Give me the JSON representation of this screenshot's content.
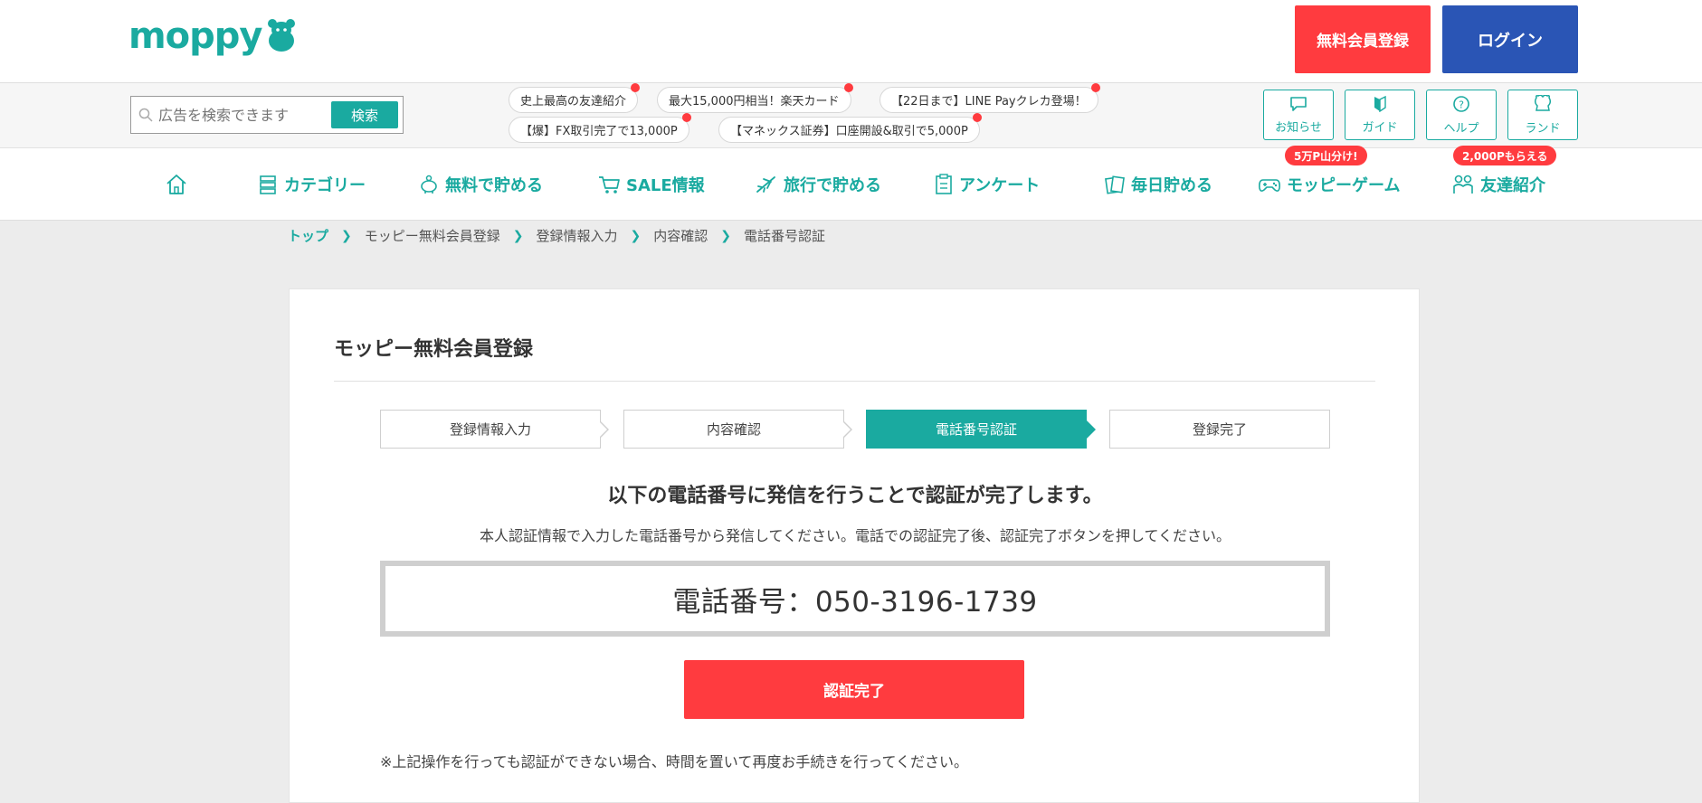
{
  "header": {
    "logo_text": "moppy",
    "register_label": "無料会員登録",
    "login_label": "ログイン"
  },
  "search": {
    "placeholder": "広告を検索できます",
    "button_label": "検索"
  },
  "promos": [
    "史上最高の友達紹介",
    "最大15,000円相当！楽天カード",
    "【22日まで】LINE Payクレカ登場！",
    "【爆】FX取引完了で13,000P",
    "【マネックス証券】口座開設&取引で5,000P"
  ],
  "utility_buttons": [
    {
      "label": "お知らせ",
      "icon": "chat-bubble-icon"
    },
    {
      "label": "ガイド",
      "icon": "beginner-mark-icon"
    },
    {
      "label": "ヘルプ",
      "icon": "help-icon"
    },
    {
      "label": "ランド",
      "icon": "mascot-icon"
    }
  ],
  "nav": {
    "items": [
      {
        "label": "",
        "icon": "home-icon"
      },
      {
        "label": "カテゴリー",
        "icon": "category-icon"
      },
      {
        "label": "無料で貯める",
        "icon": "piggy-bank-icon"
      },
      {
        "label": "SALE情報",
        "icon": "cart-icon"
      },
      {
        "label": "旅行で貯める",
        "icon": "airplane-icon"
      },
      {
        "label": "アンケート",
        "icon": "clipboard-icon"
      },
      {
        "label": "毎日貯める",
        "icon": "cards-icon"
      },
      {
        "label": "モッピーゲーム",
        "icon": "gamepad-icon"
      },
      {
        "label": "友達紹介",
        "icon": "friends-icon"
      }
    ],
    "badges": {
      "game": "5万P山分け!",
      "friends": "2,000Pもらえる"
    }
  },
  "breadcrumb": [
    "トップ",
    "モッピー無料会員登録",
    "登録情報入力",
    "内容確認",
    "電話番号認証"
  ],
  "card": {
    "title": "モッピー無料会員登録",
    "steps": [
      {
        "label": "登録情報入力",
        "active": false
      },
      {
        "label": "内容確認",
        "active": false
      },
      {
        "label": "電話番号認証",
        "active": true
      },
      {
        "label": "登録完了",
        "active": false
      }
    ],
    "headline": "以下の電話番号に発信を行うことで認証が完了します。",
    "description": "本人認証情報で入力した電話番号から発信してください。電話での認証完了後、認証完了ボタンを押してください。",
    "phone_text": "電話番号：050-3196-1739",
    "confirm_label": "認証完了",
    "note": "※上記操作を行っても認証ができない場合、時間を置いて再度お手続きを行ってください。"
  },
  "colors": {
    "brand_teal": "#1aaaa0",
    "accent_red": "#ff3b3f",
    "login_blue": "#2a55b5"
  }
}
